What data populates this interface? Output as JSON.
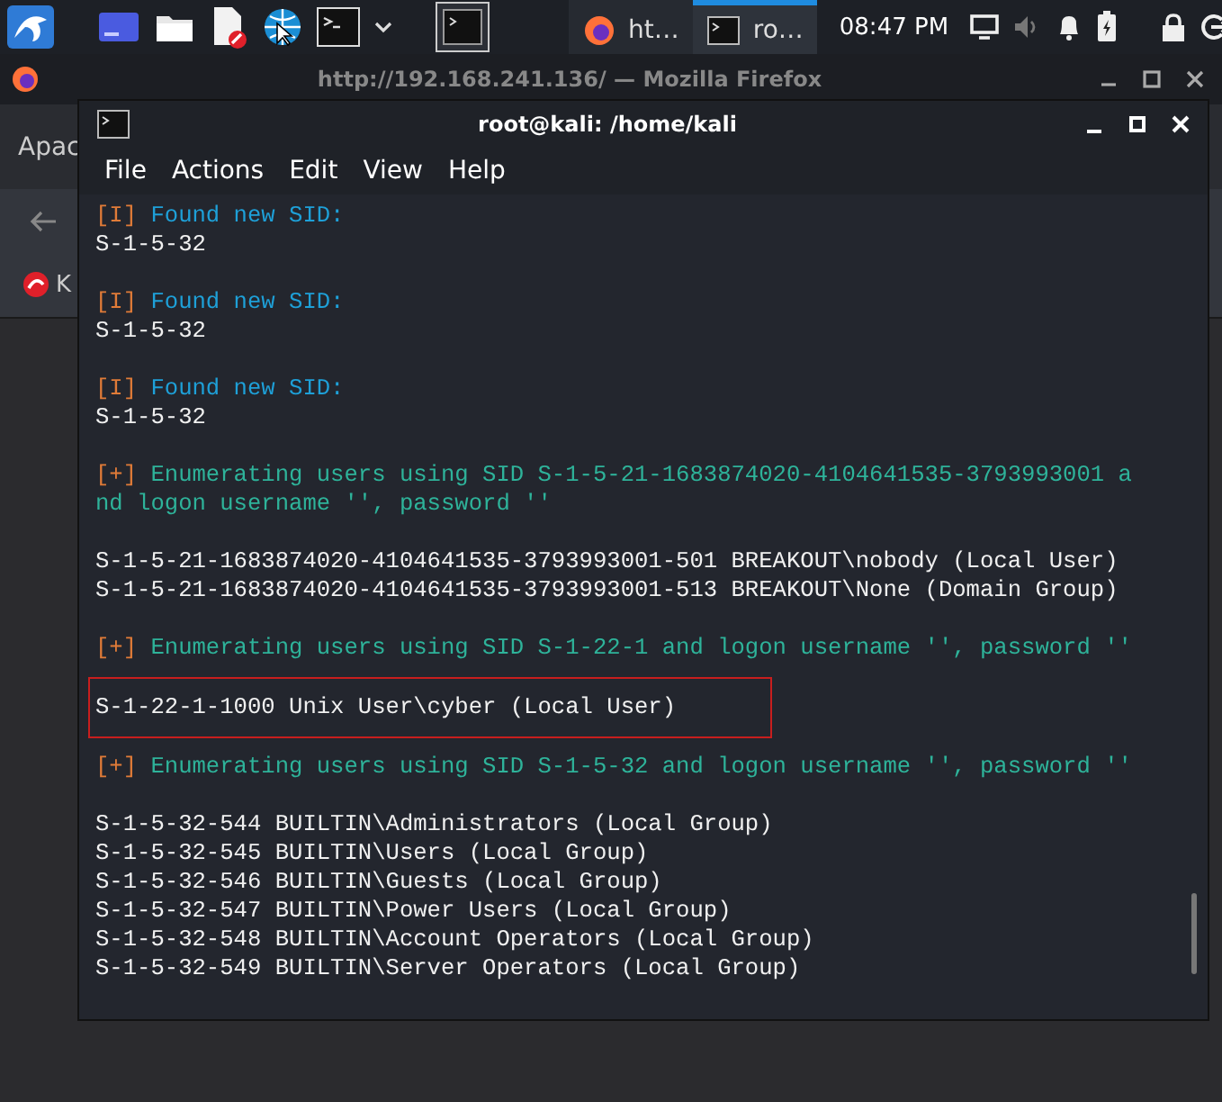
{
  "taskbar": {
    "tasks": [
      {
        "label": "ht…",
        "kind": "firefox",
        "selected": false
      },
      {
        "label": "ro…",
        "kind": "terminal",
        "selected": true
      }
    ],
    "clock": "08:47 PM"
  },
  "browser": {
    "title": "http://192.168.241.136/ — Mozilla Firefox",
    "tab": "Apac",
    "bookmark": "K"
  },
  "terminal": {
    "title": "root@kali: /home/kali",
    "menu": [
      "File",
      "Actions",
      "Edit",
      "View",
      "Help"
    ],
    "blocks": [
      {
        "highlighted": false,
        "lines": [
          {
            "kind": "info",
            "prefix": "[I]",
            "text": "Found new SID:"
          },
          {
            "kind": "plain",
            "text": "S-1-5-32"
          }
        ]
      },
      {
        "highlighted": false,
        "lines": [
          {
            "kind": "info",
            "prefix": "[I]",
            "text": "Found new SID:"
          },
          {
            "kind": "plain",
            "text": "S-1-5-32"
          }
        ]
      },
      {
        "highlighted": false,
        "lines": [
          {
            "kind": "info",
            "prefix": "[I]",
            "text": "Found new SID:"
          },
          {
            "kind": "plain",
            "text": "S-1-5-32"
          }
        ]
      },
      {
        "highlighted": false,
        "lines": [
          {
            "kind": "plus",
            "prefix": "[+]",
            "text": "Enumerating users using SID S-1-5-21-1683874020-4104641535-3793993001 a"
          },
          {
            "kind": "wrap",
            "text": "nd logon username '', password ''"
          }
        ]
      },
      {
        "highlighted": false,
        "lines": [
          {
            "kind": "plain",
            "text": "S-1-5-21-1683874020-4104641535-3793993001-501 BREAKOUT\\nobody (Local User)"
          },
          {
            "kind": "plain",
            "text": "S-1-5-21-1683874020-4104641535-3793993001-513 BREAKOUT\\None (Domain Group)"
          }
        ]
      },
      {
        "highlighted": false,
        "lines": [
          {
            "kind": "plus",
            "prefix": "[+]",
            "text": "Enumerating users using SID S-1-22-1 and logon username '', password ''"
          }
        ]
      },
      {
        "highlighted": true,
        "lines": [
          {
            "kind": "plain",
            "text": "S-1-22-1-1000 Unix User\\cyber (Local User)"
          }
        ]
      },
      {
        "highlighted": false,
        "lines": [
          {
            "kind": "plus",
            "prefix": "[+]",
            "text": "Enumerating users using SID S-1-5-32 and logon username '', password ''"
          }
        ]
      },
      {
        "highlighted": false,
        "lines": [
          {
            "kind": "plain",
            "text": "S-1-5-32-544 BUILTIN\\Administrators (Local Group)"
          },
          {
            "kind": "plain",
            "text": "S-1-5-32-545 BUILTIN\\Users (Local Group)"
          },
          {
            "kind": "plain",
            "text": "S-1-5-32-546 BUILTIN\\Guests (Local Group)"
          },
          {
            "kind": "plain",
            "text": "S-1-5-32-547 BUILTIN\\Power Users (Local Group)"
          },
          {
            "kind": "plain",
            "text": "S-1-5-32-548 BUILTIN\\Account Operators (Local Group)"
          },
          {
            "kind": "plain",
            "text": "S-1-5-32-549 BUILTIN\\Server Operators (Local Group)"
          }
        ]
      }
    ]
  }
}
